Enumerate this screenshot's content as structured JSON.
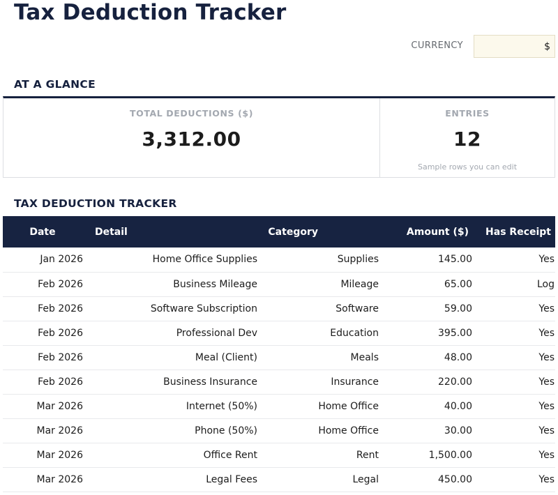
{
  "page": {
    "title": "Tax Deduction Tracker"
  },
  "currency": {
    "label": "CURRENCY",
    "value": "$"
  },
  "glance": {
    "heading": "AT A GLANCE",
    "total_label": "TOTAL DEDUCTIONS ($)",
    "total_value": "3,312.00",
    "entries_label": "ENTRIES",
    "entries_value": "12",
    "entries_note": "Sample rows you can edit"
  },
  "tracker": {
    "heading": "TAX DEDUCTION TRACKER",
    "columns": [
      "Date",
      "Detail",
      "Category",
      "Amount ($)",
      "Has Receipt"
    ],
    "rows": [
      [
        "Jan 2026",
        "Home Office Supplies",
        "Supplies",
        "145.00",
        "Yes"
      ],
      [
        "Feb 2026",
        "Business Mileage",
        "Mileage",
        "65.00",
        "Log"
      ],
      [
        "Feb 2026",
        "Software Subscription",
        "Software",
        "59.00",
        "Yes"
      ],
      [
        "Feb 2026",
        "Professional Dev",
        "Education",
        "395.00",
        "Yes"
      ],
      [
        "Feb 2026",
        "Meal (Client)",
        "Meals",
        "48.00",
        "Yes"
      ],
      [
        "Feb 2026",
        "Business Insurance",
        "Insurance",
        "220.00",
        "Yes"
      ],
      [
        "Mar 2026",
        "Internet (50%)",
        "Home Office",
        "40.00",
        "Yes"
      ],
      [
        "Mar 2026",
        "Phone (50%)",
        "Home Office",
        "30.00",
        "Yes"
      ],
      [
        "Mar 2026",
        "Office Rent",
        "Rent",
        "1,500.00",
        "Yes"
      ],
      [
        "Mar 2026",
        "Legal Fees",
        "Legal",
        "450.00",
        "Yes"
      ]
    ]
  },
  "colors": {
    "navy": "#16213e",
    "header_bg": "#172341",
    "input_bg": "#fcf9ec",
    "muted_label": "#a3a8b0"
  }
}
